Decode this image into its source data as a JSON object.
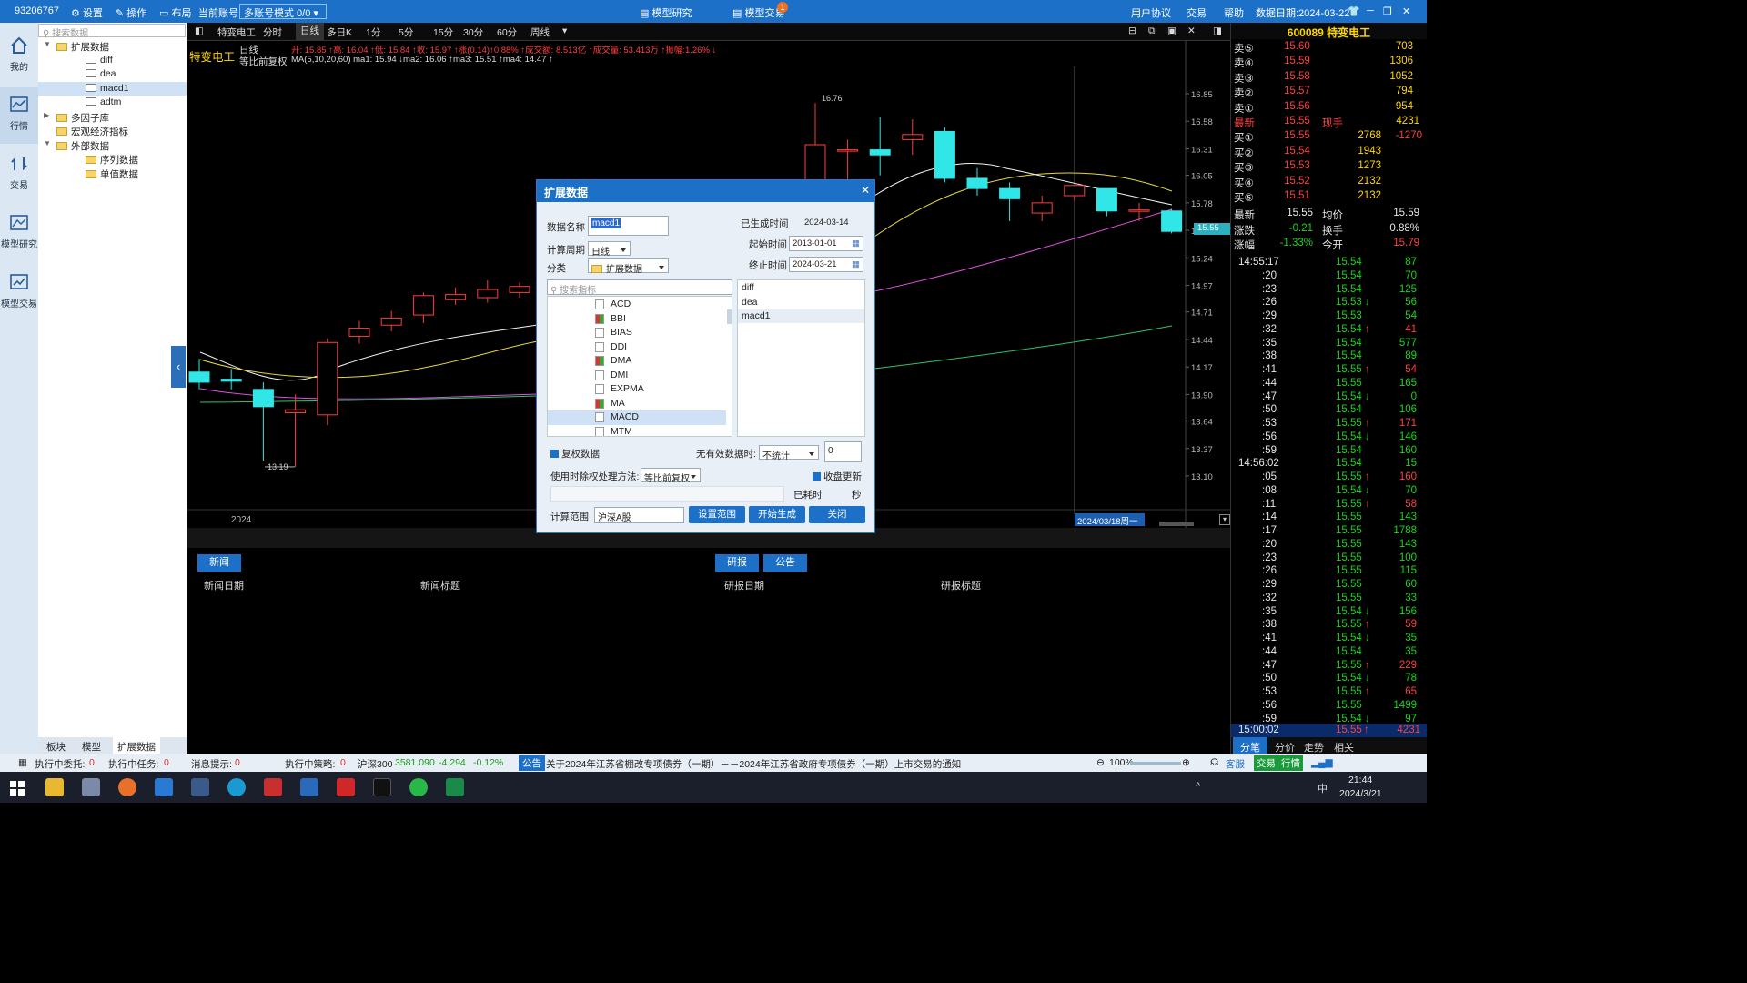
{
  "titlebar": {
    "account_id": "93206767",
    "settings": "设置",
    "operate": "操作",
    "layout": "布局",
    "current_account_label": "当前账号",
    "account_mode": "多账号模式 0/0",
    "model_research": "模型研究",
    "model_trade": "模型交易",
    "badge": "1",
    "user_agreement": "用户协议",
    "trade": "交易",
    "help": "帮助",
    "data_date": "数据日期:2024-03-22"
  },
  "leftbar": {
    "items": [
      {
        "label": "我的",
        "icon": "home-icon"
      },
      {
        "label": "行情",
        "icon": "market-chart-icon"
      },
      {
        "label": "交易",
        "icon": "trade-arrows-icon"
      },
      {
        "label": "模型研究",
        "icon": "model-research-icon"
      },
      {
        "label": "模型交易",
        "icon": "model-trade-icon"
      }
    ]
  },
  "tree": {
    "search_placeholder": "搜索数据",
    "nodes": [
      {
        "label": "扩展数据",
        "level": 0,
        "expanded": true
      },
      {
        "label": "diff",
        "level": 1
      },
      {
        "label": "dea",
        "level": 1
      },
      {
        "label": "macd1",
        "level": 1,
        "selected": true
      },
      {
        "label": "adtm",
        "level": 1
      },
      {
        "label": "多因子库",
        "level": 0,
        "expanded": false
      },
      {
        "label": "宏观经济指标",
        "level": 0
      },
      {
        "label": "外部数据",
        "level": 0,
        "expanded": true
      },
      {
        "label": "序列数据",
        "level": 1
      },
      {
        "label": "单值数据",
        "level": 1
      }
    ],
    "bottom_tabs": [
      "板块",
      "模型",
      "扩展数据"
    ]
  },
  "chart_toolbar": {
    "stock_name": "特变电工",
    "periods": [
      "分时",
      "日线",
      "多日K",
      "1分",
      "5分",
      "15分",
      "30分",
      "60分",
      "周线"
    ],
    "active_period": "日线"
  },
  "chart_header": {
    "name": "特变电工",
    "period": "日线",
    "adjust": "等比前复权",
    "ohlc_line": "开: 15.85 ↑高: 16.04 ↑低: 15.84 ↑收: 15.97 ↑涨(0.14)↑0.88% ↑成交额: 8.513亿 ↑成交量: 53.413万 ↑振幅:1.26% ↓",
    "ma_line": "MA(5,10,20,60)  ma1: 15.94 ↓ma2: 16.06 ↑ma3: 15.51 ↑ma4: 14.47 ↑"
  },
  "chart_data": {
    "type": "candlestick",
    "y_ticks": [
      "16.85",
      "16.58",
      "16.31",
      "16.05",
      "15.78",
      "15.51",
      "15.24",
      "14.97",
      "14.71",
      "14.44",
      "14.17",
      "13.90",
      "13.64",
      "13.37",
      "13.10"
    ],
    "x_label": "2024",
    "high_label": "16.76",
    "low_label": "13.19",
    "price_tag": "15.55",
    "date_tag": "2024/03/18周一",
    "candles_left": [
      {
        "o": 14.12,
        "c": 14.02,
        "h": 14.25,
        "l": 13.95
      },
      {
        "o": 14.05,
        "c": 14.03,
        "h": 14.15,
        "l": 13.95
      },
      {
        "o": 13.95,
        "c": 13.78,
        "h": 14.02,
        "l": 13.25
      },
      {
        "o": 13.72,
        "c": 13.75,
        "h": 13.9,
        "l": 13.19
      },
      {
        "o": 13.7,
        "c": 14.41,
        "h": 14.45,
        "l": 13.6
      },
      {
        "o": 14.47,
        "c": 14.55,
        "h": 14.62,
        "l": 14.4
      },
      {
        "o": 14.58,
        "c": 14.65,
        "h": 14.72,
        "l": 14.52
      },
      {
        "o": 14.68,
        "c": 14.87,
        "h": 14.9,
        "l": 14.6
      },
      {
        "o": 14.83,
        "c": 14.88,
        "h": 14.95,
        "l": 14.78
      },
      {
        "o": 14.85,
        "c": 14.93,
        "h": 15.02,
        "l": 14.8
      },
      {
        "o": 14.9,
        "c": 14.96,
        "h": 15.0,
        "l": 14.85
      }
    ],
    "candles_right": [
      {
        "o": 15.95,
        "c": 16.35,
        "h": 16.76,
        "l": 15.9
      },
      {
        "o": 16.3,
        "c": 16.3,
        "h": 16.4,
        "l": 16.0
      },
      {
        "o": 16.3,
        "c": 16.25,
        "h": 16.62,
        "l": 16.05
      },
      {
        "o": 16.4,
        "c": 16.45,
        "h": 16.6,
        "l": 16.25
      },
      {
        "o": 16.48,
        "c": 16.02,
        "h": 16.52,
        "l": 15.98
      },
      {
        "o": 16.02,
        "c": 15.92,
        "h": 16.12,
        "l": 15.85
      },
      {
        "o": 15.92,
        "c": 15.82,
        "h": 15.98,
        "l": 15.6
      },
      {
        "o": 15.68,
        "c": 15.78,
        "h": 15.85,
        "l": 15.6
      },
      {
        "o": 15.85,
        "c": 15.95,
        "h": 15.95,
        "l": 15.8
      },
      {
        "o": 15.92,
        "c": 15.7,
        "h": 15.92,
        "l": 15.65
      },
      {
        "o": 15.7,
        "c": 15.71,
        "h": 15.78,
        "l": 15.6
      },
      {
        "o": 15.7,
        "c": 15.5,
        "h": 15.72,
        "l": 15.48
      }
    ]
  },
  "news": {
    "tab_news": "新闻",
    "col_news_date": "新闻日期",
    "col_news_title": "新闻标题",
    "tab_research": "研报",
    "tab_announce": "公告",
    "col_research_date": "研报日期",
    "col_research_title": "研报标题"
  },
  "dialog": {
    "title": "扩展数据",
    "data_name_label": "数据名称",
    "data_name_value": "macd1",
    "generated_time_label": "已生成时间",
    "generated_time_value": "2024-03-14",
    "period_label": "计算周期",
    "period_value": "日线",
    "start_label": "起始时间",
    "start_value": "2013-01-01",
    "category_label": "分类",
    "category_value": "扩展数据",
    "end_label": "终止时间",
    "end_value": "2024-03-21",
    "search_placeholder": "搜索指标",
    "indicators": [
      {
        "name": "ACD",
        "colored": false
      },
      {
        "name": "BBI",
        "colored": true
      },
      {
        "name": "BIAS",
        "colored": false
      },
      {
        "name": "DDI",
        "colored": false
      },
      {
        "name": "DMA",
        "colored": true
      },
      {
        "name": "DMI",
        "colored": false
      },
      {
        "name": "EXPMA",
        "colored": false
      },
      {
        "name": "MA",
        "colored": true
      },
      {
        "name": "MACD",
        "colored": false,
        "selected": true
      },
      {
        "name": "MTM",
        "colored": false
      }
    ],
    "outputs": [
      "diff",
      "dea",
      "macd1"
    ],
    "adjust_checkbox": "复权数据",
    "invalid_data_label": "无有效数据时:",
    "invalid_data_value": "不统计",
    "invalid_data_num": "0",
    "adjust_method_label": "使用时除权处理方法:",
    "adjust_method_value": "等比前复权",
    "close_update_checkbox": "收盘更新",
    "elapsed_label": "已耗时",
    "seconds_label": "秒",
    "range_label": "计算范围",
    "range_value": "沪深A股",
    "btn_set_range": "设置范围",
    "btn_start": "开始生成",
    "btn_close": "关闭"
  },
  "quote": {
    "code_name": "600089 特变电工",
    "sells": [
      {
        "label": "卖⑤",
        "price": "15.60",
        "vol": "703"
      },
      {
        "label": "卖④",
        "price": "15.59",
        "vol": "1306"
      },
      {
        "label": "卖③",
        "price": "15.58",
        "vol": "1052"
      },
      {
        "label": "卖②",
        "price": "15.57",
        "vol": "794"
      },
      {
        "label": "卖①",
        "price": "15.56",
        "vol": "954"
      }
    ],
    "last": {
      "label": "最新",
      "price": "15.55",
      "hand_label": "现手",
      "hand": "4231"
    },
    "buys": [
      {
        "label": "买①",
        "price": "15.55",
        "vol": "2768",
        "chg": "-1270"
      },
      {
        "label": "买②",
        "price": "15.54",
        "vol": "1943",
        "chg": ""
      },
      {
        "label": "买③",
        "price": "15.53",
        "vol": "1273",
        "chg": ""
      },
      {
        "label": "买④",
        "price": "15.52",
        "vol": "2132",
        "chg": ""
      },
      {
        "label": "买⑤",
        "price": "15.51",
        "vol": "2132",
        "chg": ""
      }
    ],
    "stats": [
      {
        "l1": "最新",
        "v1": "15.55",
        "l2": "均价",
        "v2": "15.59"
      },
      {
        "l1": "涨跌",
        "v1": "-0.21",
        "l2": "换手",
        "v2": "0.88%"
      },
      {
        "l1": "涨幅",
        "v1": "-1.33%",
        "l2": "今开",
        "v2": "15.79"
      }
    ],
    "ticks": [
      {
        "t": "14:55:17",
        "p": "15.54",
        "v": "87",
        "d": ""
      },
      {
        "t": ":20",
        "p": "15.54",
        "v": "70",
        "d": ""
      },
      {
        "t": ":23",
        "p": "15.54",
        "v": "125",
        "d": ""
      },
      {
        "t": ":26",
        "p": "15.53",
        "v": "56",
        "d": "down"
      },
      {
        "t": ":29",
        "p": "15.53",
        "v": "54",
        "d": ""
      },
      {
        "t": ":32",
        "p": "15.54",
        "v": "41",
        "d": "up"
      },
      {
        "t": ":35",
        "p": "15.54",
        "v": "577",
        "d": ""
      },
      {
        "t": ":38",
        "p": "15.54",
        "v": "89",
        "d": ""
      },
      {
        "t": ":41",
        "p": "15.55",
        "v": "54",
        "d": "up"
      },
      {
        "t": ":44",
        "p": "15.55",
        "v": "165",
        "d": ""
      },
      {
        "t": ":47",
        "p": "15.54",
        "v": "0",
        "d": "down"
      },
      {
        "t": ":50",
        "p": "15.54",
        "v": "106",
        "d": ""
      },
      {
        "t": ":53",
        "p": "15.55",
        "v": "171",
        "d": "up"
      },
      {
        "t": ":56",
        "p": "15.54",
        "v": "146",
        "d": "down"
      },
      {
        "t": ":59",
        "p": "15.54",
        "v": "160",
        "d": ""
      },
      {
        "t": "14:56:02",
        "p": "15.54",
        "v": "15",
        "d": ""
      },
      {
        "t": ":05",
        "p": "15.55",
        "v": "160",
        "d": "up"
      },
      {
        "t": ":08",
        "p": "15.54",
        "v": "70",
        "d": "down"
      },
      {
        "t": ":11",
        "p": "15.55",
        "v": "58",
        "d": "up"
      },
      {
        "t": ":14",
        "p": "15.55",
        "v": "143",
        "d": ""
      },
      {
        "t": ":17",
        "p": "15.55",
        "v": "1788",
        "d": ""
      },
      {
        "t": ":20",
        "p": "15.55",
        "v": "143",
        "d": ""
      },
      {
        "t": ":23",
        "p": "15.55",
        "v": "100",
        "d": ""
      },
      {
        "t": ":26",
        "p": "15.55",
        "v": "115",
        "d": ""
      },
      {
        "t": ":29",
        "p": "15.55",
        "v": "60",
        "d": ""
      },
      {
        "t": ":32",
        "p": "15.55",
        "v": "33",
        "d": ""
      },
      {
        "t": ":35",
        "p": "15.54",
        "v": "156",
        "d": "down"
      },
      {
        "t": ":38",
        "p": "15.55",
        "v": "59",
        "d": "up"
      },
      {
        "t": ":41",
        "p": "15.54",
        "v": "35",
        "d": "down"
      },
      {
        "t": ":44",
        "p": "15.54",
        "v": "35",
        "d": ""
      },
      {
        "t": ":47",
        "p": "15.55",
        "v": "229",
        "d": "up"
      },
      {
        "t": ":50",
        "p": "15.54",
        "v": "78",
        "d": "down"
      },
      {
        "t": ":53",
        "p": "15.55",
        "v": "65",
        "d": "up"
      },
      {
        "t": ":56",
        "p": "15.55",
        "v": "1499",
        "d": ""
      },
      {
        "t": ":59",
        "p": "15.54",
        "v": "97",
        "d": "down"
      }
    ],
    "last_tick": {
      "t": "15:00:02",
      "p": "15.55",
      "v": "4231"
    },
    "bottom_tabs": [
      "分笔",
      "分价",
      "走势",
      "相关"
    ]
  },
  "statusbar": {
    "exec_entrust_label": "执行中委托:",
    "exec_entrust_val": "0",
    "exec_task_label": "执行中任务:",
    "exec_task_val": "0",
    "msg_label": "消息提示:",
    "msg_val": "0",
    "exec_strategy_label": "执行中策略:",
    "exec_strategy_val": "0",
    "index_name": "沪深300",
    "index_val": "3581.090",
    "index_chg": "-4.294",
    "index_pct": "-0.12%",
    "announce_tag": "公告",
    "announce_text": "关于2024年江苏省棚改专项债券（一期）－－2024年江苏省政府专项债券（一期）上市交易的通知",
    "zoom": "100%",
    "service": "客服",
    "trade": "交易",
    "market": "行情"
  },
  "taskbar": {
    "time": "21:44",
    "date": "2024/3/21",
    "ime": "中"
  }
}
